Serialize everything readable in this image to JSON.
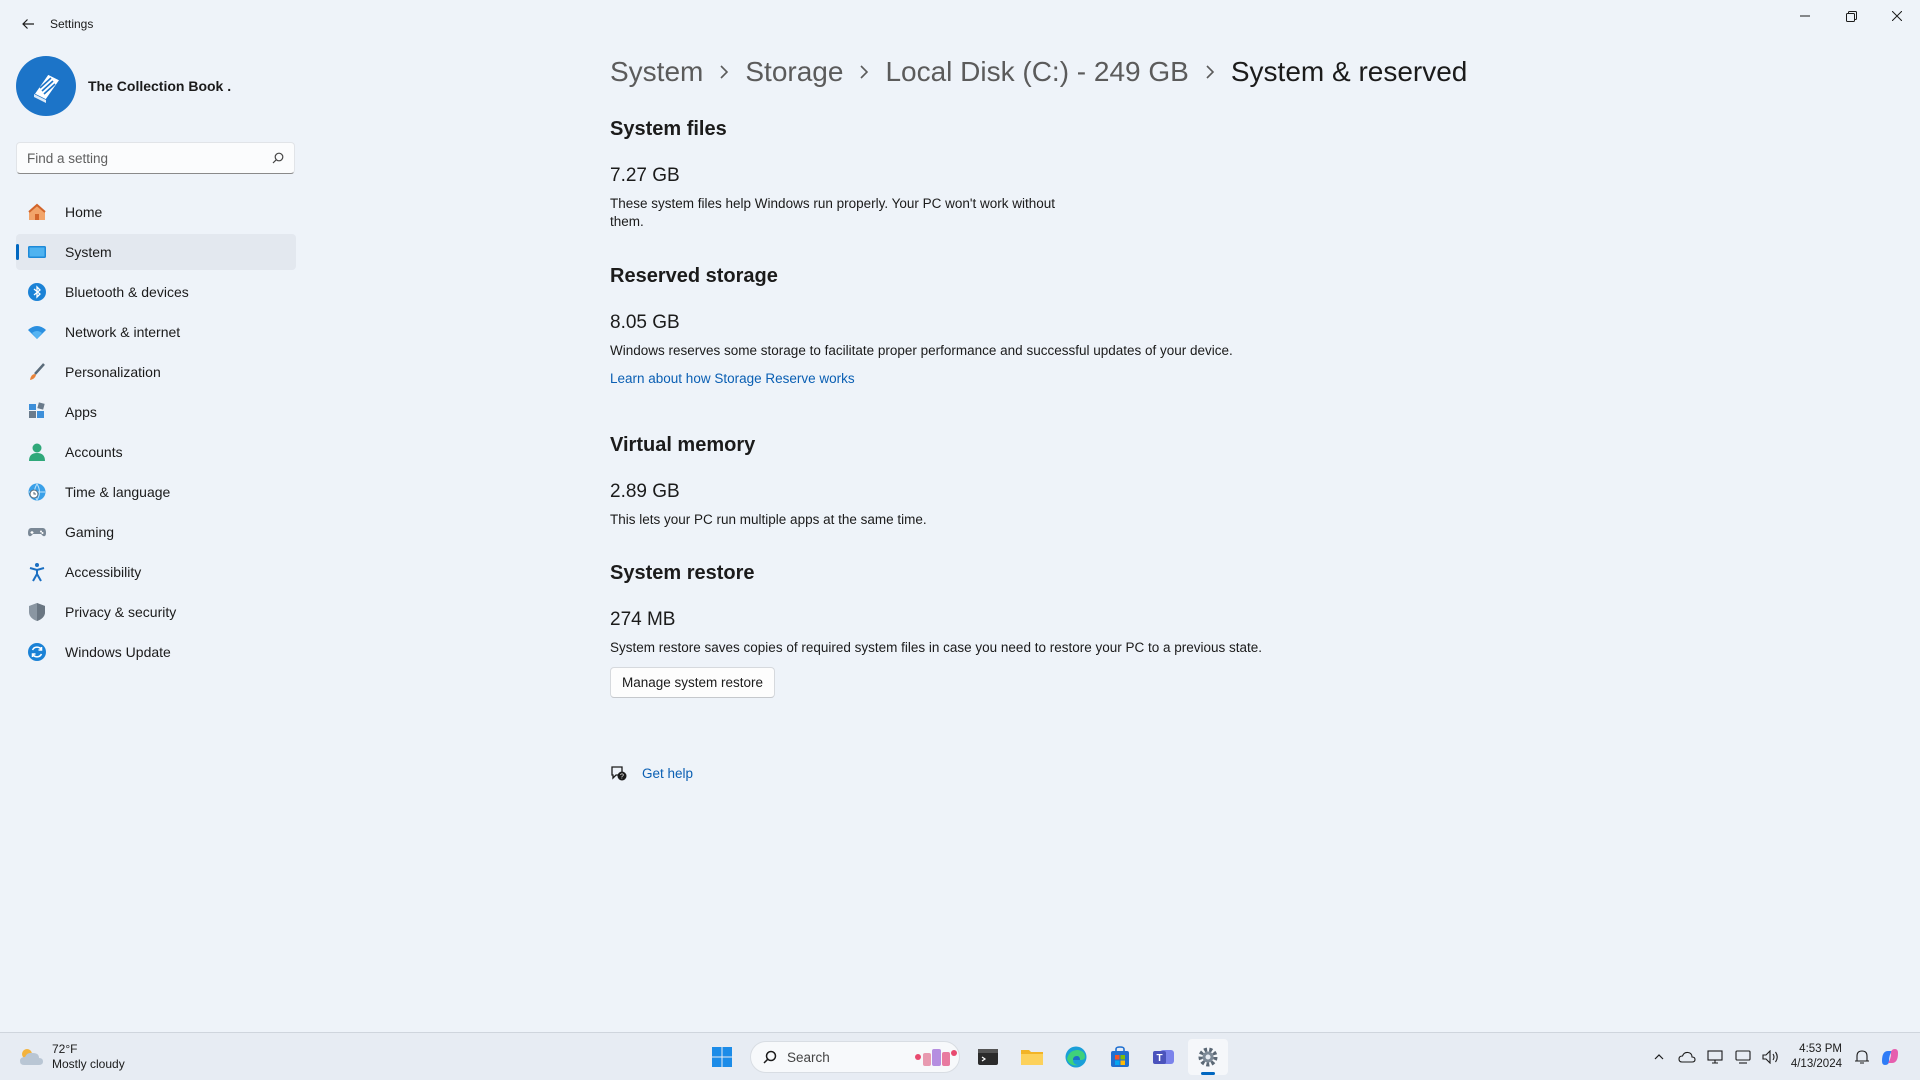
{
  "window": {
    "app_title": "Settings"
  },
  "profile": {
    "name": "The Collection Book ."
  },
  "search": {
    "placeholder": "Find a setting"
  },
  "nav": {
    "items": [
      {
        "label": "Home"
      },
      {
        "label": "System"
      },
      {
        "label": "Bluetooth & devices"
      },
      {
        "label": "Network & internet"
      },
      {
        "label": "Personalization"
      },
      {
        "label": "Apps"
      },
      {
        "label": "Accounts"
      },
      {
        "label": "Time & language"
      },
      {
        "label": "Gaming"
      },
      {
        "label": "Accessibility"
      },
      {
        "label": "Privacy & security"
      },
      {
        "label": "Windows Update"
      }
    ],
    "active": "System"
  },
  "breadcrumb": {
    "items": [
      "System",
      "Storage",
      "Local Disk (C:) - 249 GB",
      "System & reserved"
    ]
  },
  "sections": {
    "system_files": {
      "title": "System files",
      "size": "7.27 GB",
      "description": "These system files help Windows run properly. Your PC won't work without them."
    },
    "reserved_storage": {
      "title": "Reserved storage",
      "size": "8.05 GB",
      "description": "Windows reserves some storage to facilitate proper performance and successful updates of your device.",
      "link": "Learn about how Storage Reserve works"
    },
    "virtual_memory": {
      "title": "Virtual memory",
      "size": "2.89 GB",
      "description": "This lets your PC run multiple apps at the same time."
    },
    "system_restore": {
      "title": "System restore",
      "size": "274 MB",
      "description": "System restore saves copies of required system files in case you need to restore your PC to a previous state.",
      "button": "Manage system restore"
    }
  },
  "help": {
    "label": "Get help"
  },
  "taskbar": {
    "weather_temp": "72°F",
    "weather_desc": "Mostly cloudy",
    "search_label": "Search",
    "time": "4:53 PM",
    "date": "4/13/2024"
  },
  "colors": {
    "accent": "#0067c0",
    "link": "#0a5fb3",
    "background": "#eef3f9"
  }
}
